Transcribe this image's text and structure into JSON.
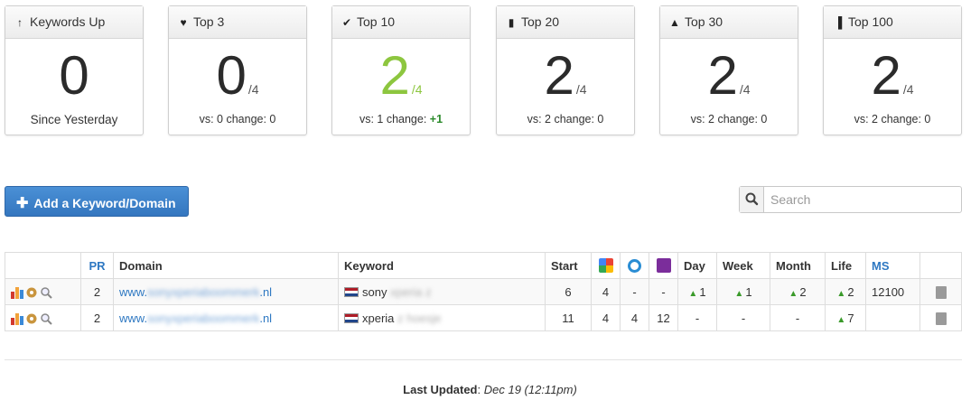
{
  "cards": [
    {
      "icon": "arrow-up-icon",
      "glyph": "↑",
      "title": "Keywords Up",
      "value": "0",
      "suffix": "",
      "footer": "Since Yesterday",
      "change": ""
    },
    {
      "icon": "heart-icon",
      "glyph": "♥",
      "title": "Top 3",
      "value": "0",
      "suffix": "/4",
      "footer": "vs: 0 change: 0",
      "change": ""
    },
    {
      "icon": "checkmark-icon",
      "glyph": "✔",
      "title": "Top 10",
      "value": "2",
      "suffix": "/4",
      "footer": "vs: 1 change: ",
      "change": "+1"
    },
    {
      "icon": "bookmark-icon",
      "glyph": "▮",
      "title": "Top 20",
      "value": "2",
      "suffix": "/4",
      "footer": "vs: 2 change: 0",
      "change": ""
    },
    {
      "icon": "road-icon",
      "glyph": "▲",
      "title": "Top 30",
      "value": "2",
      "suffix": "/4",
      "footer": "vs: 2 change: 0",
      "change": ""
    },
    {
      "icon": "signal-bars-icon",
      "glyph": "▐",
      "title": "Top 100",
      "value": "2",
      "suffix": "/4",
      "footer": "vs: 2 change: 0",
      "change": ""
    }
  ],
  "toolbar": {
    "add_label": "Add a Keyword/Domain",
    "search_placeholder": "Search"
  },
  "table": {
    "headers": {
      "pr": "PR",
      "domain": "Domain",
      "keyword": "Keyword",
      "start": "Start",
      "day": "Day",
      "week": "Week",
      "month": "Month",
      "life": "Life",
      "ms": "MS"
    },
    "rows": [
      {
        "pr": "2",
        "domain_prefix": "www.",
        "domain_blur": "sonyxperiaboommerk",
        "domain_suffix": ".nl",
        "keyword": "sony",
        "keyword_blur": "xperia z",
        "start": "6",
        "google": "4",
        "bing": "-",
        "yahoo": "-",
        "day": "1",
        "week": "1",
        "month": "2",
        "life": "2",
        "ms": "12100"
      },
      {
        "pr": "2",
        "domain_prefix": "www.",
        "domain_blur": "sonyxperiaboommerk",
        "domain_suffix": ".nl",
        "keyword": "xperia",
        "keyword_blur": "z hoesje",
        "start": "11",
        "google": "4",
        "bing": "4",
        "yahoo": "12",
        "day": "-",
        "week": "-",
        "month": "-",
        "life": "7",
        "ms": ""
      }
    ]
  },
  "footer": {
    "label": "Last Updated",
    "value": "Dec 19 (12:11pm)"
  }
}
